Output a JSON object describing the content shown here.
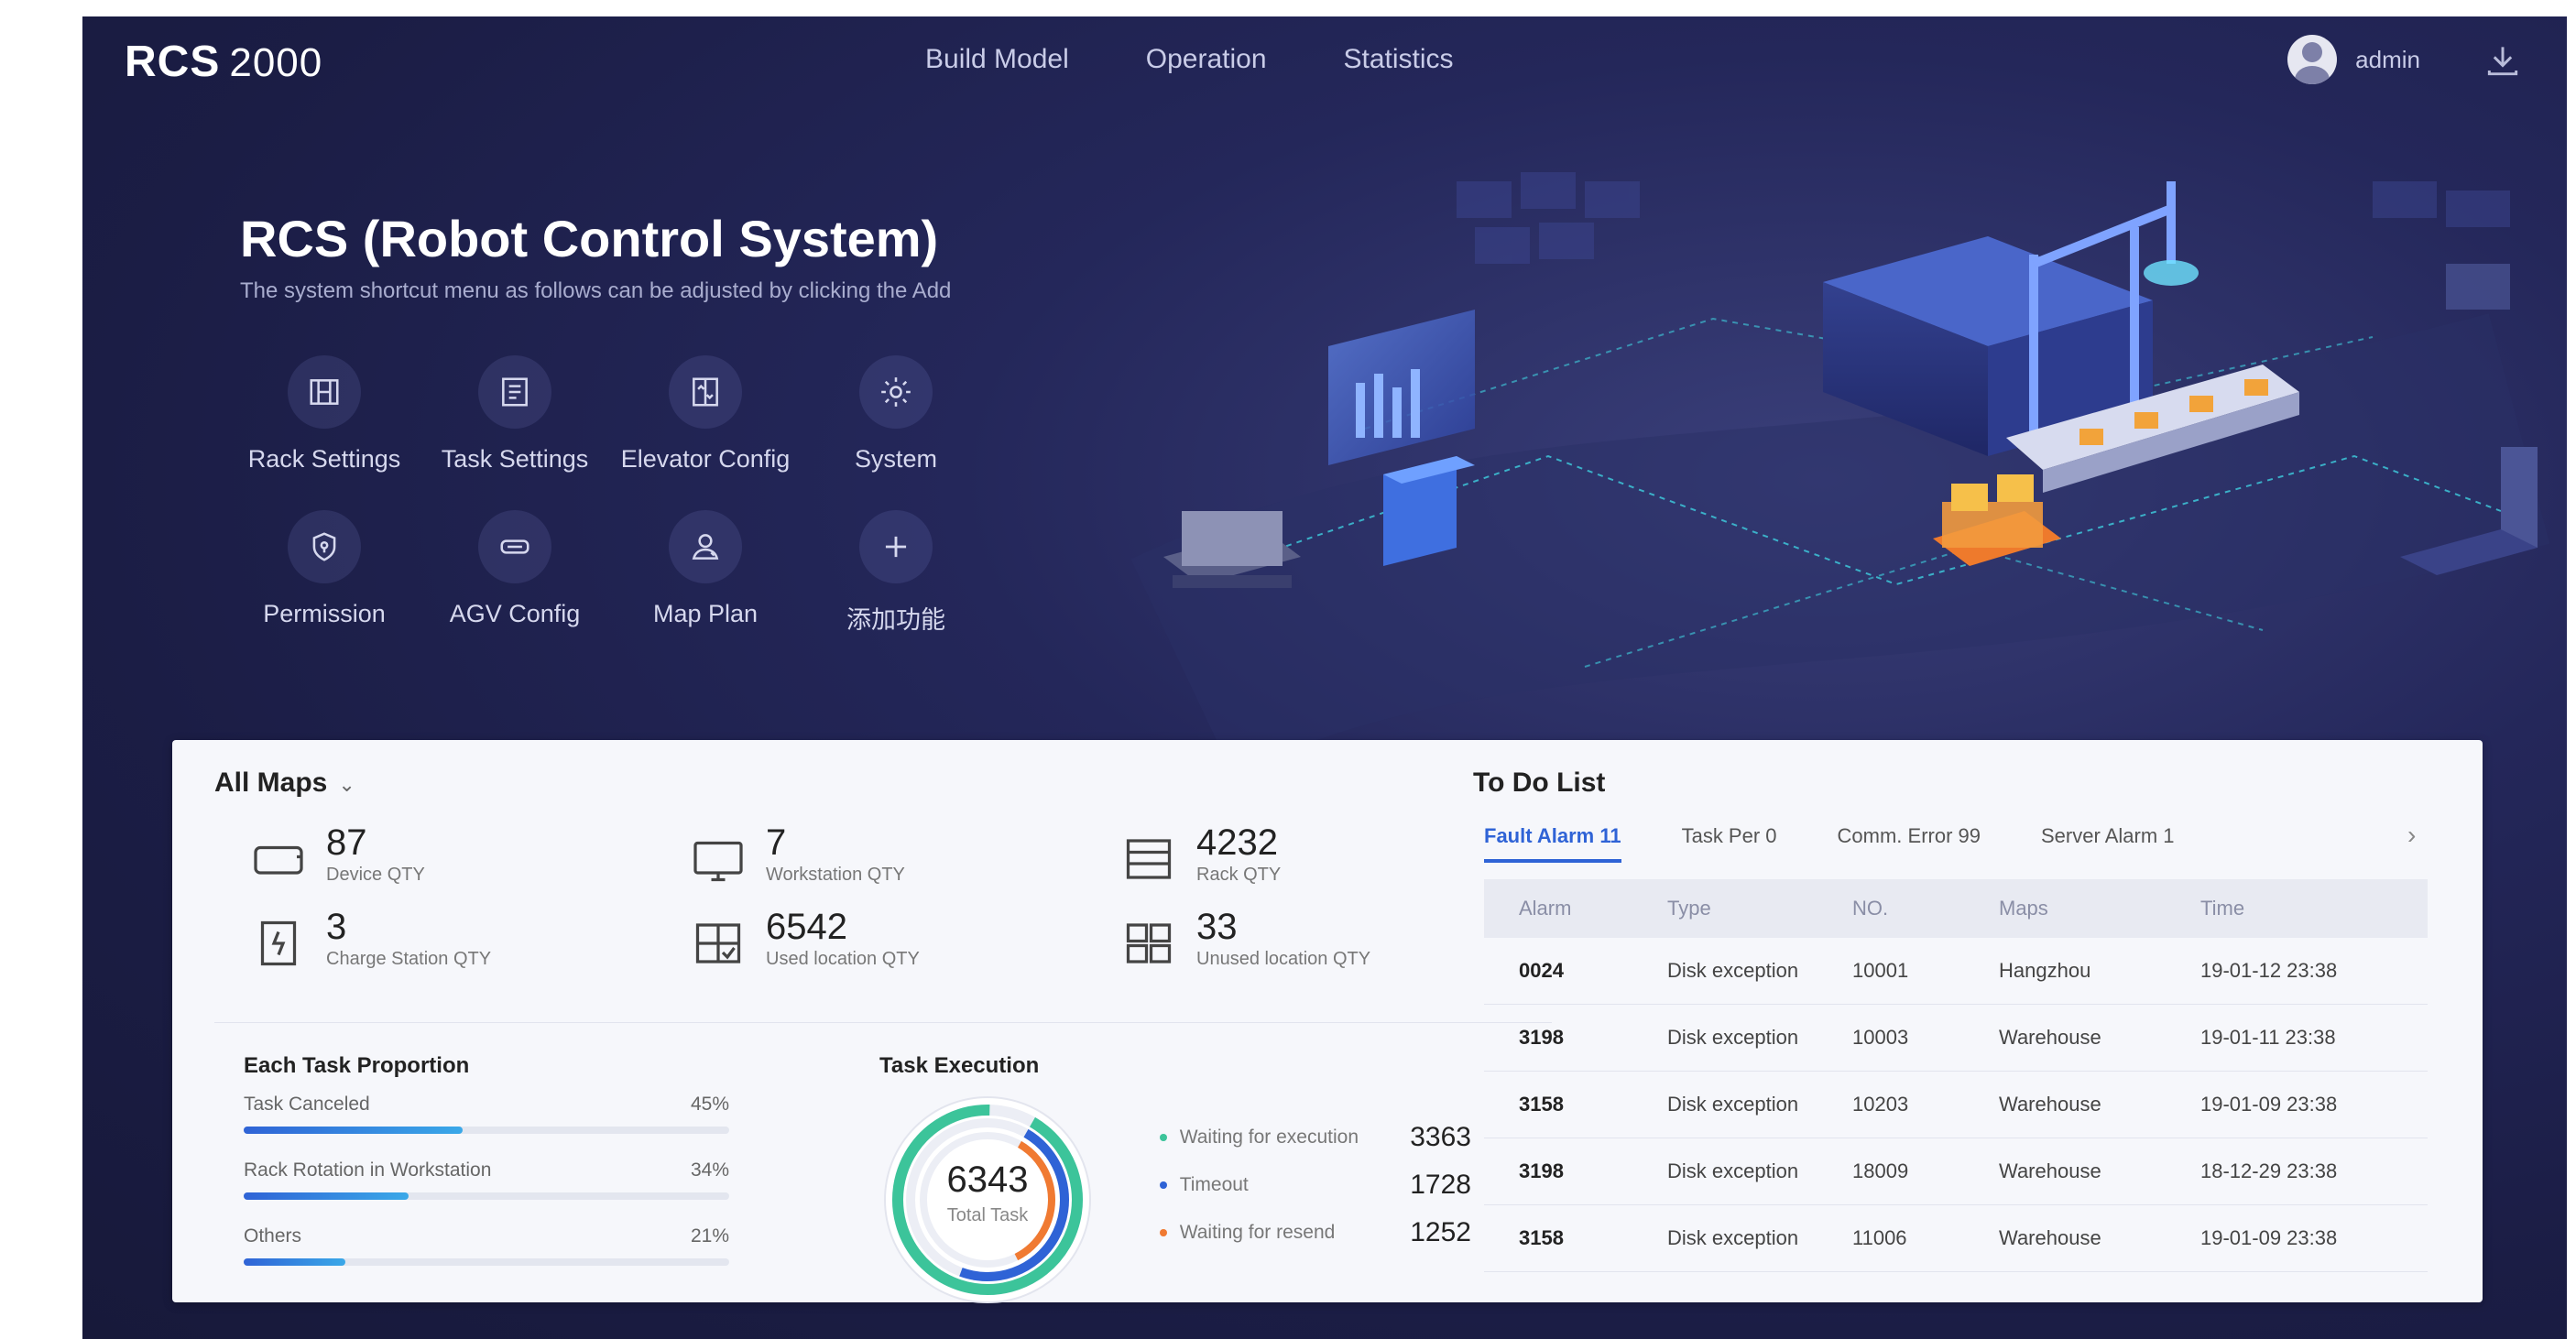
{
  "app": {
    "logo": "RCS",
    "version": "2000"
  },
  "nav": {
    "items": [
      "Build Model",
      "Operation",
      "Statistics"
    ]
  },
  "user": {
    "name": "admin"
  },
  "hero": {
    "title": "RCS (Robot Control System)",
    "subtitle": "The system shortcut menu as follows can be adjusted by clicking the Add"
  },
  "shortcuts": [
    {
      "label": "Rack Settings",
      "icon": "rack-settings-icon"
    },
    {
      "label": "Task Settings",
      "icon": "task-settings-icon"
    },
    {
      "label": "Elevator Config",
      "icon": "elevator-config-icon"
    },
    {
      "label": "System",
      "icon": "system-gear-icon"
    },
    {
      "label": "Permission",
      "icon": "permission-shield-icon"
    },
    {
      "label": "AGV Config",
      "icon": "agv-config-icon"
    },
    {
      "label": "Map Plan",
      "icon": "map-plan-icon"
    },
    {
      "label": "添加功能",
      "icon": "add-plus-icon"
    }
  ],
  "maps": {
    "selected": "All Maps"
  },
  "stats": [
    {
      "value": "87",
      "label": "Device QTY",
      "icon": "device-icon"
    },
    {
      "value": "7",
      "label": "Workstation QTY",
      "icon": "workstation-monitor-icon"
    },
    {
      "value": "4232",
      "label": "Rack QTY",
      "icon": "rack-icon"
    },
    {
      "value": "3",
      "label": "Charge Station QTY",
      "icon": "charge-station-icon"
    },
    {
      "value": "6542",
      "label": "Used location QTY",
      "icon": "used-location-icon"
    },
    {
      "value": "33",
      "label": "Unused location QTY",
      "icon": "unused-location-icon"
    }
  ],
  "task_proportion": {
    "title": "Each Task Proportion",
    "items": [
      {
        "name": "Task Canceled",
        "percent": "45%",
        "value": 45
      },
      {
        "name": "Rack Rotation in Workstation",
        "percent": "34%",
        "value": 34
      },
      {
        "name": "Others",
        "percent": "21%",
        "value": 21
      }
    ]
  },
  "task_execution": {
    "title": "Task Execution",
    "total": "6343",
    "total_label": "Total Task",
    "items": [
      {
        "name": "Waiting for execution",
        "value": 3363,
        "display": "3363",
        "color": "#3cc49a"
      },
      {
        "name": "Timeout",
        "value": 1728,
        "display": "1728",
        "color": "#2f63d6"
      },
      {
        "name": "Waiting for resend",
        "value": 1252,
        "display": "1252",
        "color": "#f07a32"
      }
    ]
  },
  "todo": {
    "title": "To Do List",
    "tabs": [
      "Fault Alarm 11",
      "Task Per 0",
      "Comm. Error 99",
      "Server Alarm 1"
    ],
    "active_tab": 0,
    "columns": [
      "Alarm",
      "Type",
      "NO.",
      "Maps",
      "Time"
    ],
    "rows": [
      [
        "0024",
        "Disk exception",
        "10001",
        "Hangzhou",
        "19-01-12 23:38"
      ],
      [
        "3198",
        "Disk exception",
        "10003",
        "Warehouse",
        "19-01-11 23:38"
      ],
      [
        "3158",
        "Disk exception",
        "10203",
        "Warehouse",
        "19-01-09 23:38"
      ],
      [
        "3198",
        "Disk exception",
        "18009",
        "Warehouse",
        "18-12-29 23:38"
      ],
      [
        "3158",
        "Disk exception",
        "11006",
        "Warehouse",
        "19-01-09 23:38"
      ]
    ]
  },
  "colors": {
    "accent": "#2f63d6",
    "nav_bg": "#1f2250",
    "panel_bg": "#f6f7fb"
  }
}
